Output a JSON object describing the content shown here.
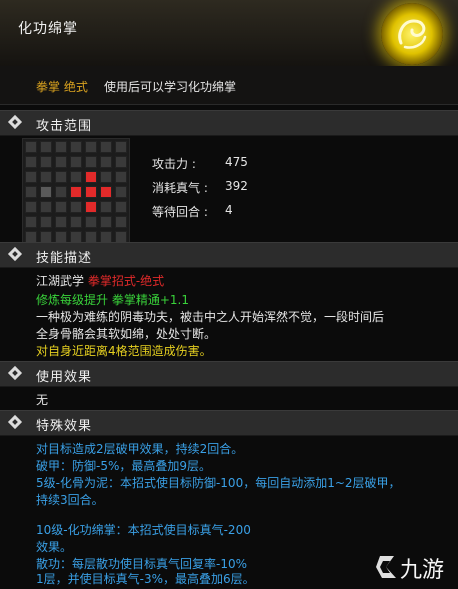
{
  "title": "化功绵掌",
  "subheader": {
    "class": "拳掌 绝式",
    "desc": "使用后可以学习化功绵掌"
  },
  "sections": {
    "range": "攻击范围",
    "description": "技能描述",
    "use_effect": "使用效果",
    "special_effect": "特殊效果"
  },
  "stats": [
    {
      "label": "攻击力 :",
      "value": "475"
    },
    {
      "label": "消耗真气 :",
      "value": "392"
    },
    {
      "label": "等待回合 :",
      "value": "4"
    }
  ],
  "description": {
    "school_prefix": "江湖武学",
    "school_type": "拳掌招式-绝式",
    "growth": "修炼每级提升 拳掌精通+1.1",
    "text_1": "一种极为难练的阴毒功夫，被击中之人开始浑然不觉，一段时间后",
    "text_2": "全身骨骼会其软如绵，处处寸断。",
    "range_effect": "对自身近距离4格范围造成伤害。"
  },
  "use_effect": "无",
  "special_effects": [
    "对目标造成2层破甲效果，持续2回合。",
    "破甲：防御-5%，最高叠加9层。",
    "5级-化骨为泥：本招式使目标防御-100，每回自动添加1~2层破甲，",
    "持续3回合。",
    "",
    "10级-化功绵掌：本招式使目标真气-200",
    "效果。",
    "散功：每层散功使目标真气回复率-10%",
    "1层，并使目标真气-3%，最高叠加6层。"
  ],
  "watermark": "九游",
  "colors": {
    "highlight": "#e22a2a",
    "emblem": "#f2d600",
    "effect_text": "#3aa0e6"
  }
}
